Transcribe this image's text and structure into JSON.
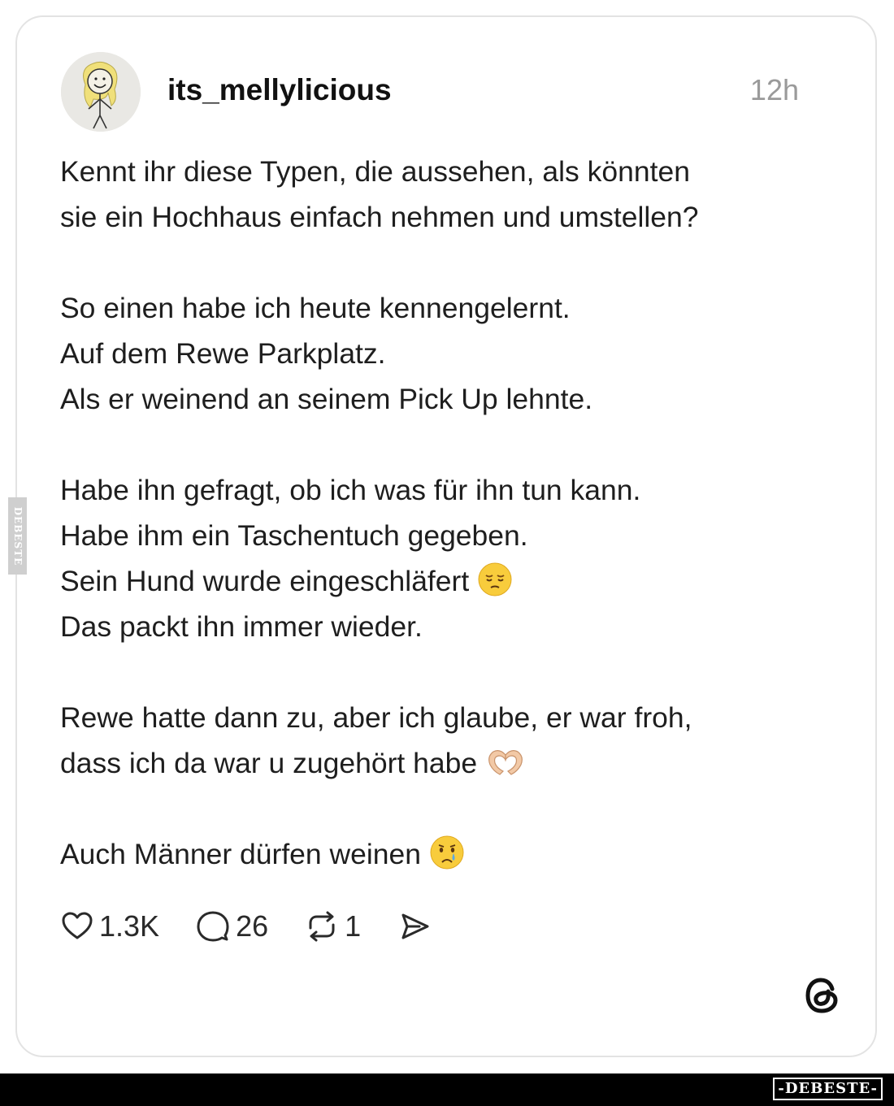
{
  "post": {
    "username": "its_mellylicious",
    "time": "12h",
    "lines": [
      "Kennt ihr diese Typen, die aussehen, als könnten",
      "sie ein Hochhaus einfach nehmen und umstellen?",
      "",
      "So einen habe ich heute kennengelernt.",
      "Auf dem Rewe Parkplatz.",
      "Als er weinend an seinem Pick Up lehnte.",
      "",
      "Habe ihn gefragt, ob ich was für ihn tun kann.",
      "Habe ihm ein Taschentuch gegeben.",
      "Sein Hund wurde eingeschläfert",
      "Das packt ihn immer wieder.",
      "",
      "Rewe hatte dann zu, aber ich glaube, er war froh,",
      "dass ich da war u zugehört habe",
      "",
      "Auch Männer dürfen weinen"
    ],
    "emojis": {
      "pensive": "pensive-face-emoji",
      "heart_hands": "heart-hands-emoji",
      "crying": "crying-face-emoji"
    }
  },
  "actions": {
    "likes": "1.3K",
    "comments": "26",
    "reposts": "1"
  },
  "icons": {
    "like": "heart-icon",
    "comment": "comment-bubble-icon",
    "repost": "repost-icon",
    "share": "share-send-icon",
    "app": "threads-logo-icon"
  },
  "watermarks": {
    "side": "DEBESTE",
    "footer": "-DEBESTE-"
  },
  "colors": {
    "text": "#1e1e1e",
    "muted": "#9a9a9a",
    "card_border": "#e3e3e3",
    "footer": "#000000"
  }
}
